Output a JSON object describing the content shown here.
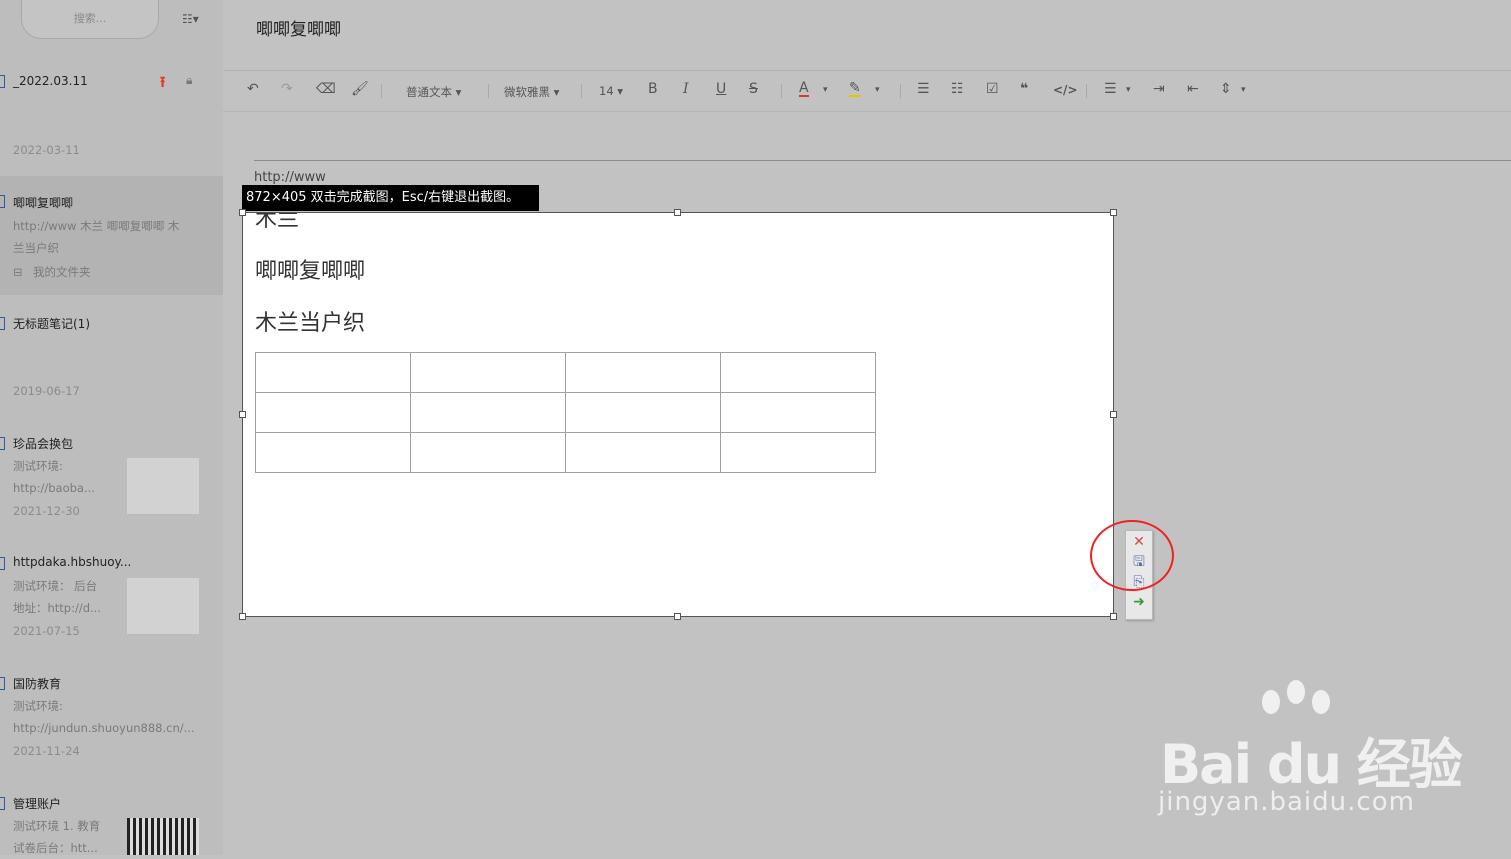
{
  "window": {
    "title": "唧唧复唧唧"
  },
  "sidebar": {
    "search_placeholder": "搜索...",
    "sort_icon": "list-sort-icon",
    "notes": [
      {
        "title": "_2022.03.11",
        "pinned": true,
        "locked": true,
        "date": "2022-03-11"
      },
      {
        "title": "唧唧复唧唧",
        "snippet_line1": "http://www 木兰 唧唧复唧唧 木",
        "snippet_line2": "兰当户织",
        "folder": "我的文件夹",
        "selected": true
      },
      {
        "title": "无标题笔记(1)",
        "date": "2019-06-17"
      },
      {
        "title": "珍品会换包",
        "snippet_line1": "测试环境:",
        "snippet_line2": "http://baoba...",
        "date": "2021-12-30"
      },
      {
        "title": "httpdaka.hbshuoy...",
        "snippet_line1": "测试环境：  后台",
        "snippet_line2": "地址：http://d...",
        "date": "2021-07-15"
      },
      {
        "title": "国防教育",
        "snippet_line1": "测试环境:",
        "snippet_line2": "http://jundun.shuoyun888.cn/...",
        "date": "2021-11-24"
      },
      {
        "title": "管理账户",
        "snippet_line1": "测试环境 1. 教育",
        "snippet_line2": "试卷后台：htt..."
      }
    ]
  },
  "toolbar": {
    "undo_icon": "undo-icon",
    "redo_icon": "redo-icon",
    "eraser_icon": "eraser-icon",
    "format_painter_icon": "format-painter-icon",
    "paragraph_style": "普通文本",
    "font_family": "微软雅黑",
    "font_size": "14",
    "bold": "B",
    "italic": "I",
    "underline": "U",
    "strike": "S"
  },
  "editor": {
    "url_text": "http://www",
    "line1": "木兰",
    "line2": "唧唧复唧唧",
    "line3": "木兰当户织",
    "table": {
      "rows": 3,
      "cols": 4
    }
  },
  "screenshot_overlay": {
    "info": "872×405  双击完成截图，Esc/右键退出截图。",
    "tools": [
      "close-icon",
      "save-icon",
      "copy-icon",
      "send-icon"
    ]
  },
  "watermark": {
    "logo_text": "Bai du 经验",
    "url": "jingyan.baidu.com"
  },
  "colors": {
    "overlay_dim": "#c2c2c2",
    "highlight_circle": "#e22222",
    "pin_red": "#e8332a"
  }
}
